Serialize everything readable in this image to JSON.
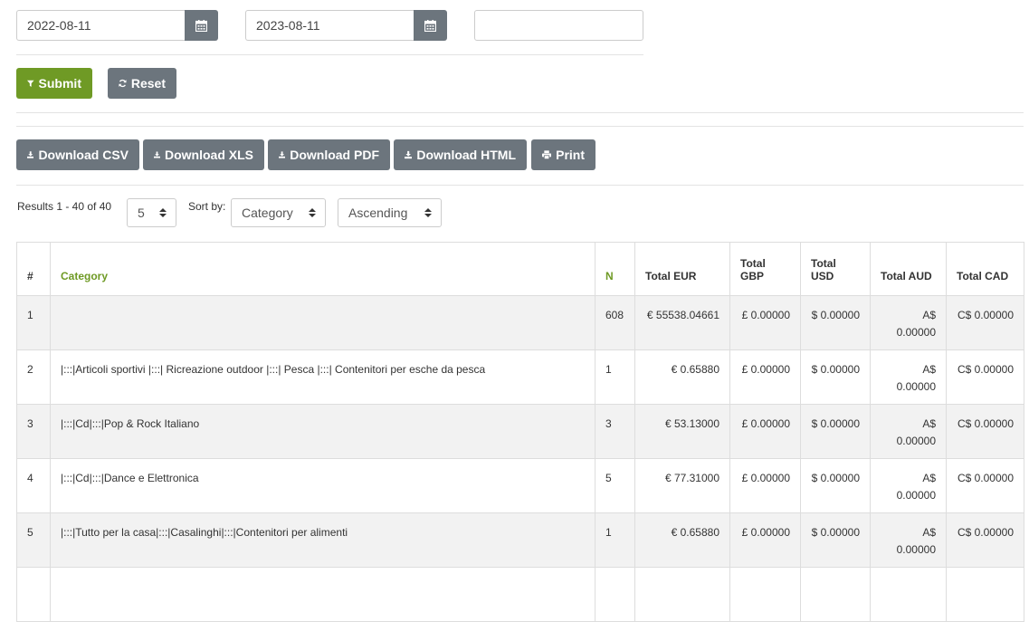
{
  "filters": {
    "date_from": "2022-08-11",
    "date_to": "2023-08-11",
    "extra_value": ""
  },
  "buttons": {
    "submit": "Submit",
    "reset": "Reset",
    "download_csv": "Download CSV",
    "download_xls": "Download XLS",
    "download_pdf": "Download PDF",
    "download_html": "Download HTML",
    "print": "Print"
  },
  "results": {
    "summary": "Results 1 - 40 of 40",
    "per_page": "5",
    "sort_label": "Sort by:",
    "sort_field": "Category",
    "sort_order": "Ascending"
  },
  "colors": {
    "accent": "#6f9a25",
    "button_gray": "#6c757d"
  },
  "table": {
    "headers": {
      "idx": "#",
      "category": "Category",
      "n": "N",
      "eur": "Total EUR",
      "gbp": "Total GBP",
      "usd": "Total USD",
      "aud": "Total AUD",
      "cad": "Total CAD"
    },
    "rows": [
      {
        "idx": "1",
        "category": "",
        "n": "608",
        "eur": "€ 55538.04661",
        "gbp": "£ 0.00000",
        "usd": "$ 0.00000",
        "aud": "A$ 0.00000",
        "cad": "C$ 0.00000"
      },
      {
        "idx": "2",
        "category": "|:::|Articoli sportivi |:::| Ricreazione outdoor |:::| Pesca |:::| Contenitori per esche da pesca",
        "n": "1",
        "eur": "€ 0.65880",
        "gbp": "£ 0.00000",
        "usd": "$ 0.00000",
        "aud": "A$ 0.00000",
        "cad": "C$ 0.00000"
      },
      {
        "idx": "3",
        "category": "|:::|Cd|:::|Pop & Rock Italiano",
        "n": "3",
        "eur": "€ 53.13000",
        "gbp": "£ 0.00000",
        "usd": "$ 0.00000",
        "aud": "A$ 0.00000",
        "cad": "C$ 0.00000"
      },
      {
        "idx": "4",
        "category": "|:::|Cd|:::|Dance e Elettronica",
        "n": "5",
        "eur": "€ 77.31000",
        "gbp": "£ 0.00000",
        "usd": "$ 0.00000",
        "aud": "A$ 0.00000",
        "cad": "C$ 0.00000"
      },
      {
        "idx": "5",
        "category": "|:::|Tutto per la casa|:::|Casalinghi|:::|Contenitori per alimenti",
        "n": "1",
        "eur": "€ 0.65880",
        "gbp": "£ 0.00000",
        "usd": "$ 0.00000",
        "aud": "A$ 0.00000",
        "cad": "C$ 0.00000"
      }
    ]
  }
}
